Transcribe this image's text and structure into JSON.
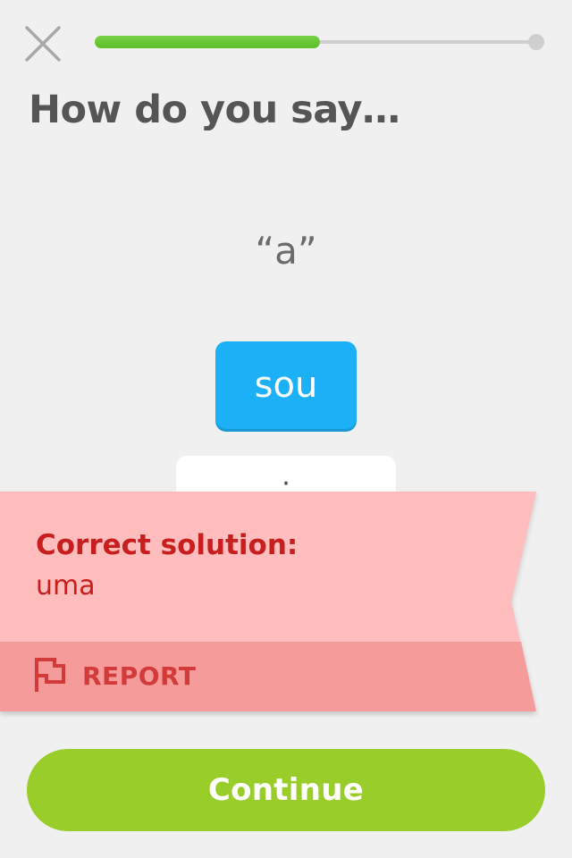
{
  "header": {
    "close_icon": "close-icon",
    "progress_fraction": 0.51
  },
  "question": {
    "title": "How do you say…",
    "prompt": "“a”"
  },
  "tiles": {
    "selected": "sou",
    "bank_partial": "·"
  },
  "feedback": {
    "heading": "Correct solution:",
    "solution": "uma",
    "report_label": "REPORT",
    "report_icon": "flag-icon"
  },
  "footer": {
    "continue_label": "Continue"
  },
  "colors": {
    "progress": "#5cbf2a",
    "tile_selected": "#1cb0f6",
    "ribbon_bg": "#ffbdbd",
    "ribbon_report_bg": "#f59c9b",
    "error_text": "#c81e1e",
    "continue_bg": "#99cd2a"
  }
}
